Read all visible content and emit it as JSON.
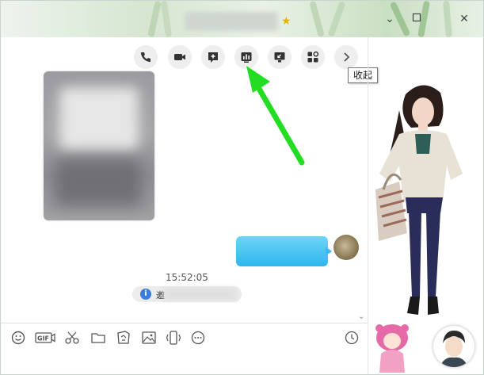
{
  "window": {
    "title_star": "★",
    "controls": {
      "minimize": "⌄",
      "close": "✕"
    }
  },
  "toolbar": {
    "buttons": [
      {
        "name": "call-button",
        "icon": "phone-icon"
      },
      {
        "name": "video-call-button",
        "icon": "video-camera-icon"
      },
      {
        "name": "add-chat-button",
        "icon": "plus-bubble-icon"
      },
      {
        "name": "poll-button",
        "icon": "bar-chart-icon"
      },
      {
        "name": "screen-share-button",
        "icon": "screen-share-icon"
      },
      {
        "name": "apps-button",
        "icon": "apps-icon"
      },
      {
        "name": "more-arrow-button",
        "icon": "chevron-right-icon"
      }
    ],
    "tooltip": "收起"
  },
  "chat": {
    "timestamp": "15:52:05",
    "notice_prefix": "邀"
  },
  "input_toolbar": {
    "gif_label": "GIF",
    "icons": [
      "smile-icon",
      "gif-icon",
      "scissors-icon",
      "folder-icon",
      "sticker-icon",
      "image-icon",
      "shake-icon",
      "more-icon",
      "history-clock-icon"
    ]
  },
  "colors": {
    "accent_green_arrow": "#22dd22",
    "bubble_blue": "#2fb6ee",
    "info_blue": "#3b7dd8"
  }
}
